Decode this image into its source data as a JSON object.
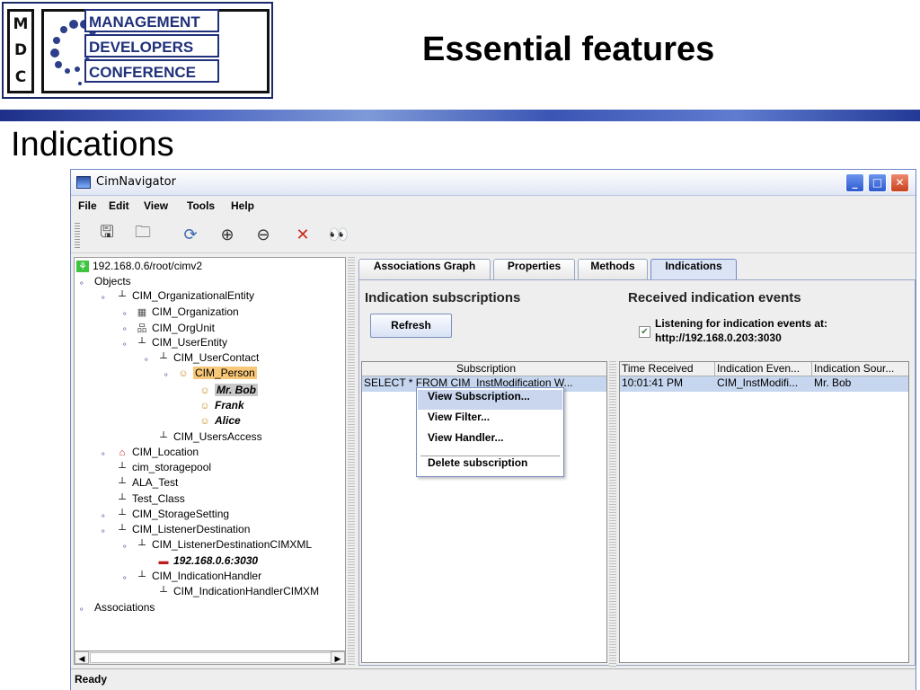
{
  "slide": {
    "logo_letters": [
      "M",
      "D",
      "C"
    ],
    "logo_lines": [
      "MANAGEMENT",
      "DEVELOPERS",
      "CONFERENCE"
    ],
    "title": "Essential features",
    "subtitle": "Indications"
  },
  "window": {
    "title": "CimNavigator",
    "controls": {
      "minimize": "_",
      "maximize": "□",
      "close": "✕"
    }
  },
  "menu": [
    "File",
    "Edit",
    "View",
    "Tools",
    "Help"
  ],
  "toolbar": {
    "icons": [
      "save-icon",
      "open-folder-icon",
      "refresh-icon",
      "zoom-in-icon",
      "zoom-out-icon",
      "network-icon",
      "binoculars-icon"
    ],
    "glyphs": [
      "🖫",
      "🗀",
      "⟳",
      "⊕",
      "⊖",
      "✕",
      "👀"
    ]
  },
  "tree": [
    {
      "label": "192.168.0.6/root/cimv2",
      "icon": "server-icon"
    },
    {
      "label": "Objects",
      "icon": ""
    },
    {
      "label": "CIM_OrganizationalEntity",
      "icon": "class-icon"
    },
    {
      "label": "CIM_Organization",
      "icon": "organization-icon"
    },
    {
      "label": "CIM_OrgUnit",
      "icon": "org-unit-icon"
    },
    {
      "label": "CIM_UserEntity",
      "icon": "class-icon"
    },
    {
      "label": "CIM_UserContact",
      "icon": "class-icon"
    },
    {
      "label": "CIM_Person",
      "icon": "person-icon"
    },
    {
      "label": "Mr. Bob",
      "icon": "person-icon"
    },
    {
      "label": "Frank",
      "icon": "person-icon"
    },
    {
      "label": "Alice",
      "icon": "person-icon"
    },
    {
      "label": "CIM_UsersAccess",
      "icon": "class-icon"
    },
    {
      "label": "CIM_Location",
      "icon": "house-icon"
    },
    {
      "label": "cim_storagepool",
      "icon": "class-icon"
    },
    {
      "label": "ALA_Test",
      "icon": "class-icon"
    },
    {
      "label": "Test_Class",
      "icon": "class-icon"
    },
    {
      "label": "CIM_StorageSetting",
      "icon": "class-icon"
    },
    {
      "label": "CIM_ListenerDestination",
      "icon": "class-icon"
    },
    {
      "label": "CIM_ListenerDestinationCIMXML",
      "icon": "class-icon"
    },
    {
      "label": "192.168.0.6:3030",
      "icon": "listener-icon"
    },
    {
      "label": "CIM_IndicationHandler",
      "icon": "class-icon"
    },
    {
      "label": "CIM_IndicationHandlerCIMXM",
      "icon": "class-icon"
    },
    {
      "label": "Associations",
      "icon": ""
    }
  ],
  "tabs": [
    "Associations Graph",
    "Properties",
    "Methods",
    "Indications"
  ],
  "active_tab": "Indications",
  "indications": {
    "subscriptions_heading": "Indication subscriptions",
    "events_heading": "Received indication events",
    "refresh_label": "Refresh",
    "listening_line1": "Listening for indication events at:",
    "listening_line2": "http://192.168.0.203:3030",
    "listening_checked": true,
    "subscription_table": {
      "columns": [
        "Subscription"
      ],
      "rows": [
        [
          "SELECT * FROM CIM_InstModification W..."
        ]
      ]
    },
    "events_table": {
      "columns": [
        "Time Received",
        "Indication Even...",
        "Indication Sour..."
      ],
      "rows": [
        [
          "10:01:41 PM",
          "CIM_InstModifi...",
          "Mr. Bob"
        ]
      ]
    }
  },
  "context_menu": [
    "View Subscription...",
    "View Filter...",
    "View Handler...",
    "Delete subscription"
  ],
  "status": "Ready"
}
